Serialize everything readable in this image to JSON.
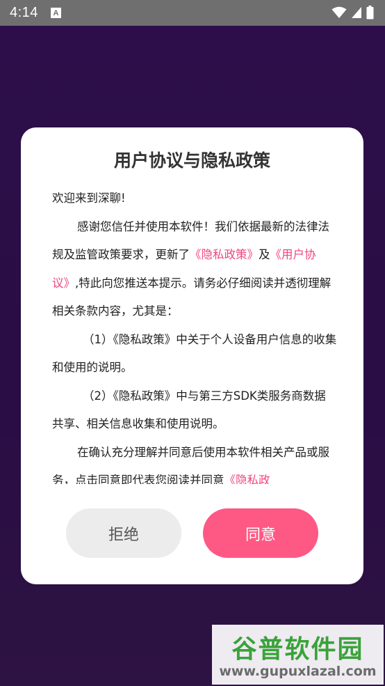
{
  "status_bar": {
    "time": "4:14",
    "notification_glyph": "A",
    "icons": [
      "wifi-icon",
      "cell-signal-icon",
      "battery-icon"
    ]
  },
  "dialog": {
    "title": "用户协议与隐私政策",
    "paragraphs": {
      "greeting": "欢迎来到深聊!",
      "p1_a": "感谢您信任并使用本软件！我们依据最新的法律法规及监管政策要求，更新了",
      "p1_link1": "《隐私政策》",
      "p1_b": "及",
      "p1_link2": "《用户协议》",
      "p1_c": ",特此向您推送本提示。请务必仔细阅读并透彻理解相关条款内容，尤其是：",
      "item1": "（1）《隐私政策》中关于个人设备用户信息的收集和使用的说明。",
      "item2": "（2）《隐私政策》中与第三方SDK类服务商数据共享、相关信息收集和使用说明。",
      "p2_a": "在确认充分理解并同意后使用本软件相关产品或服务，点击同意即代表您阅读并同意",
      "p2_link": "《隐私政"
    },
    "buttons": {
      "refuse": "拒绝",
      "agree": "同意"
    }
  },
  "colors": {
    "accent": "#fe5884",
    "link": "#f0457f",
    "background": "#2c0f45",
    "status_bar": "#6f6f70"
  },
  "watermark": {
    "title": "谷普软件园",
    "url": "www.gupuxlazal.com"
  }
}
